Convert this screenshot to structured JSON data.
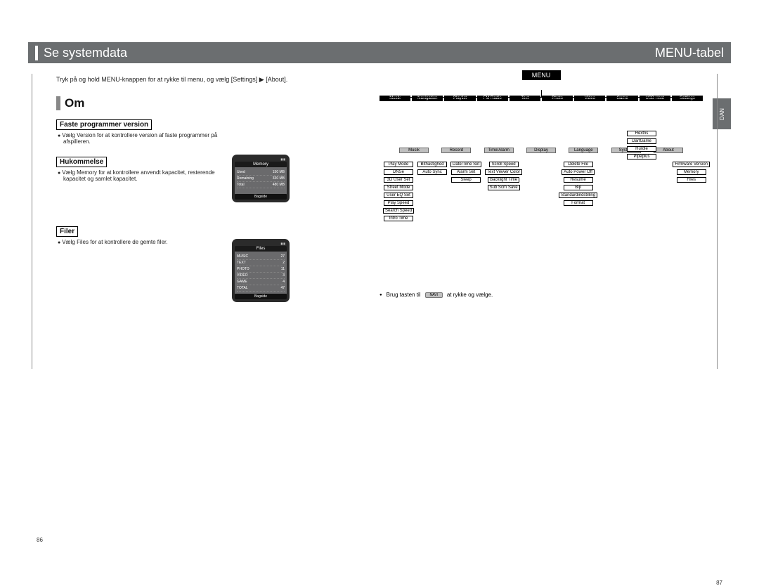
{
  "header": {
    "left": "Se systemdata",
    "right": "MENU-tabel"
  },
  "lang_tab": "DAN",
  "left_page": {
    "intro": "Tryk på og hold MENU-knappen for at rykke til menu, og vælg [Settings]  ▶ [About].",
    "heading": "Om",
    "sections": {
      "firmware": {
        "title": "Faste programmer version",
        "desc": "Vælg Version for at kontrollere version af faste programmer på afspilleren."
      },
      "memory": {
        "title": "Hukommelse",
        "desc": "Vælg Memory for at kontrollere anvendt kapacitet, resterende kapacitet og samlet kapacitet."
      },
      "files": {
        "title": "Filer",
        "desc": "Vælg Files for at kontrollere de gemte filer."
      }
    },
    "device_memory": {
      "top_left": "",
      "top_right": "",
      "title": "Memory",
      "rows": [
        {
          "label": "Used",
          "value": "150 MB"
        },
        {
          "label": "Remaining",
          "value": "330 MB"
        },
        {
          "label": "Total",
          "value": "480 MB"
        }
      ],
      "foot": "Bagside"
    },
    "device_files": {
      "title": "Files",
      "rows": [
        {
          "label": "MUSIC",
          "value": "27"
        },
        {
          "label": "TEXT",
          "value": "2"
        },
        {
          "label": "PHOTO",
          "value": "11"
        },
        {
          "label": "VIDEO",
          "value": "3"
        },
        {
          "label": "GAME",
          "value": "4"
        },
        {
          "label": "TOTAL",
          "value": "47"
        }
      ],
      "foot": "Bagside"
    },
    "page_number": "86"
  },
  "right_page": {
    "root": "MENU",
    "top_nodes": [
      "Musik",
      "Navigation",
      "Playlist",
      "FM Radio",
      "Text",
      "Photo",
      "Video",
      "Game",
      "USB Host",
      "Settings"
    ],
    "games": [
      "Hextris",
      "DartGame",
      "Hurdle",
      "Pipeplus"
    ],
    "settings_groups": [
      "Musik",
      "Record",
      "Time/Alarm",
      "Display",
      "Language",
      "System",
      "About"
    ],
    "cols": {
      "musik": [
        "Play Mode",
        "DNSe",
        "3D User Set",
        "Street Mode",
        "User EQ Set",
        "Play Speed",
        "Search Speed",
        "Intro Time"
      ],
      "record": [
        "Bithastighed",
        "Auto Sync"
      ],
      "time": [
        "Date/Time Set",
        "Alarm Set",
        "Sleep"
      ],
      "display": [
        "Scroll Speed",
        "Text Viewer Color",
        "Backlight Time",
        "Sub Scrn Save"
      ],
      "system": [
        "Delete File",
        "Auto Power Off",
        "Resume",
        "Bip",
        "Standardindstilling",
        "Format"
      ],
      "about": [
        "Firmware Version",
        "Memory",
        "Files"
      ]
    },
    "footer_note_pre": "Brug tasten til",
    "footer_note_chip": "NAVI",
    "footer_note_post": "at rykke og vælge.",
    "page_number": "87"
  }
}
